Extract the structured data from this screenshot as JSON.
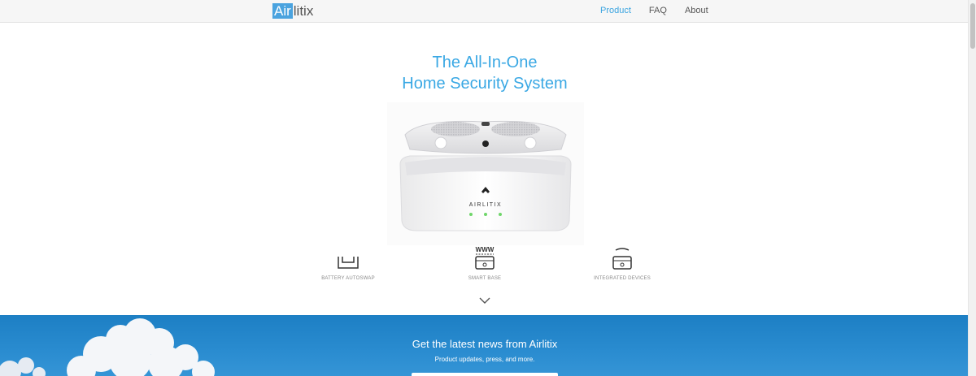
{
  "brand": {
    "logo_highlight": "Air",
    "logo_rest": "litix"
  },
  "nav": {
    "items": [
      {
        "label": "Product",
        "active": true
      },
      {
        "label": "FAQ",
        "active": false
      },
      {
        "label": "About",
        "active": false
      }
    ]
  },
  "hero": {
    "title_line1": "The All-In-One",
    "title_line2": "Home Security System",
    "product_brand": "AIRLITIX"
  },
  "features": [
    {
      "label": "BATTERY AUTOSWAP",
      "icon": "battery-autoswap-icon"
    },
    {
      "label": "SMART BASE",
      "icon": "smart-base-icon",
      "icon_text": "WWW"
    },
    {
      "label": "INTEGRATED DEVICES",
      "icon": "integrated-devices-icon"
    }
  ],
  "banner": {
    "title": "Get the latest news from Airlitix",
    "subtitle": "Product updates, press, and more."
  },
  "colors": {
    "accent": "#3aa4e0",
    "banner": "#2a8cd0",
    "text_muted": "#888888"
  }
}
